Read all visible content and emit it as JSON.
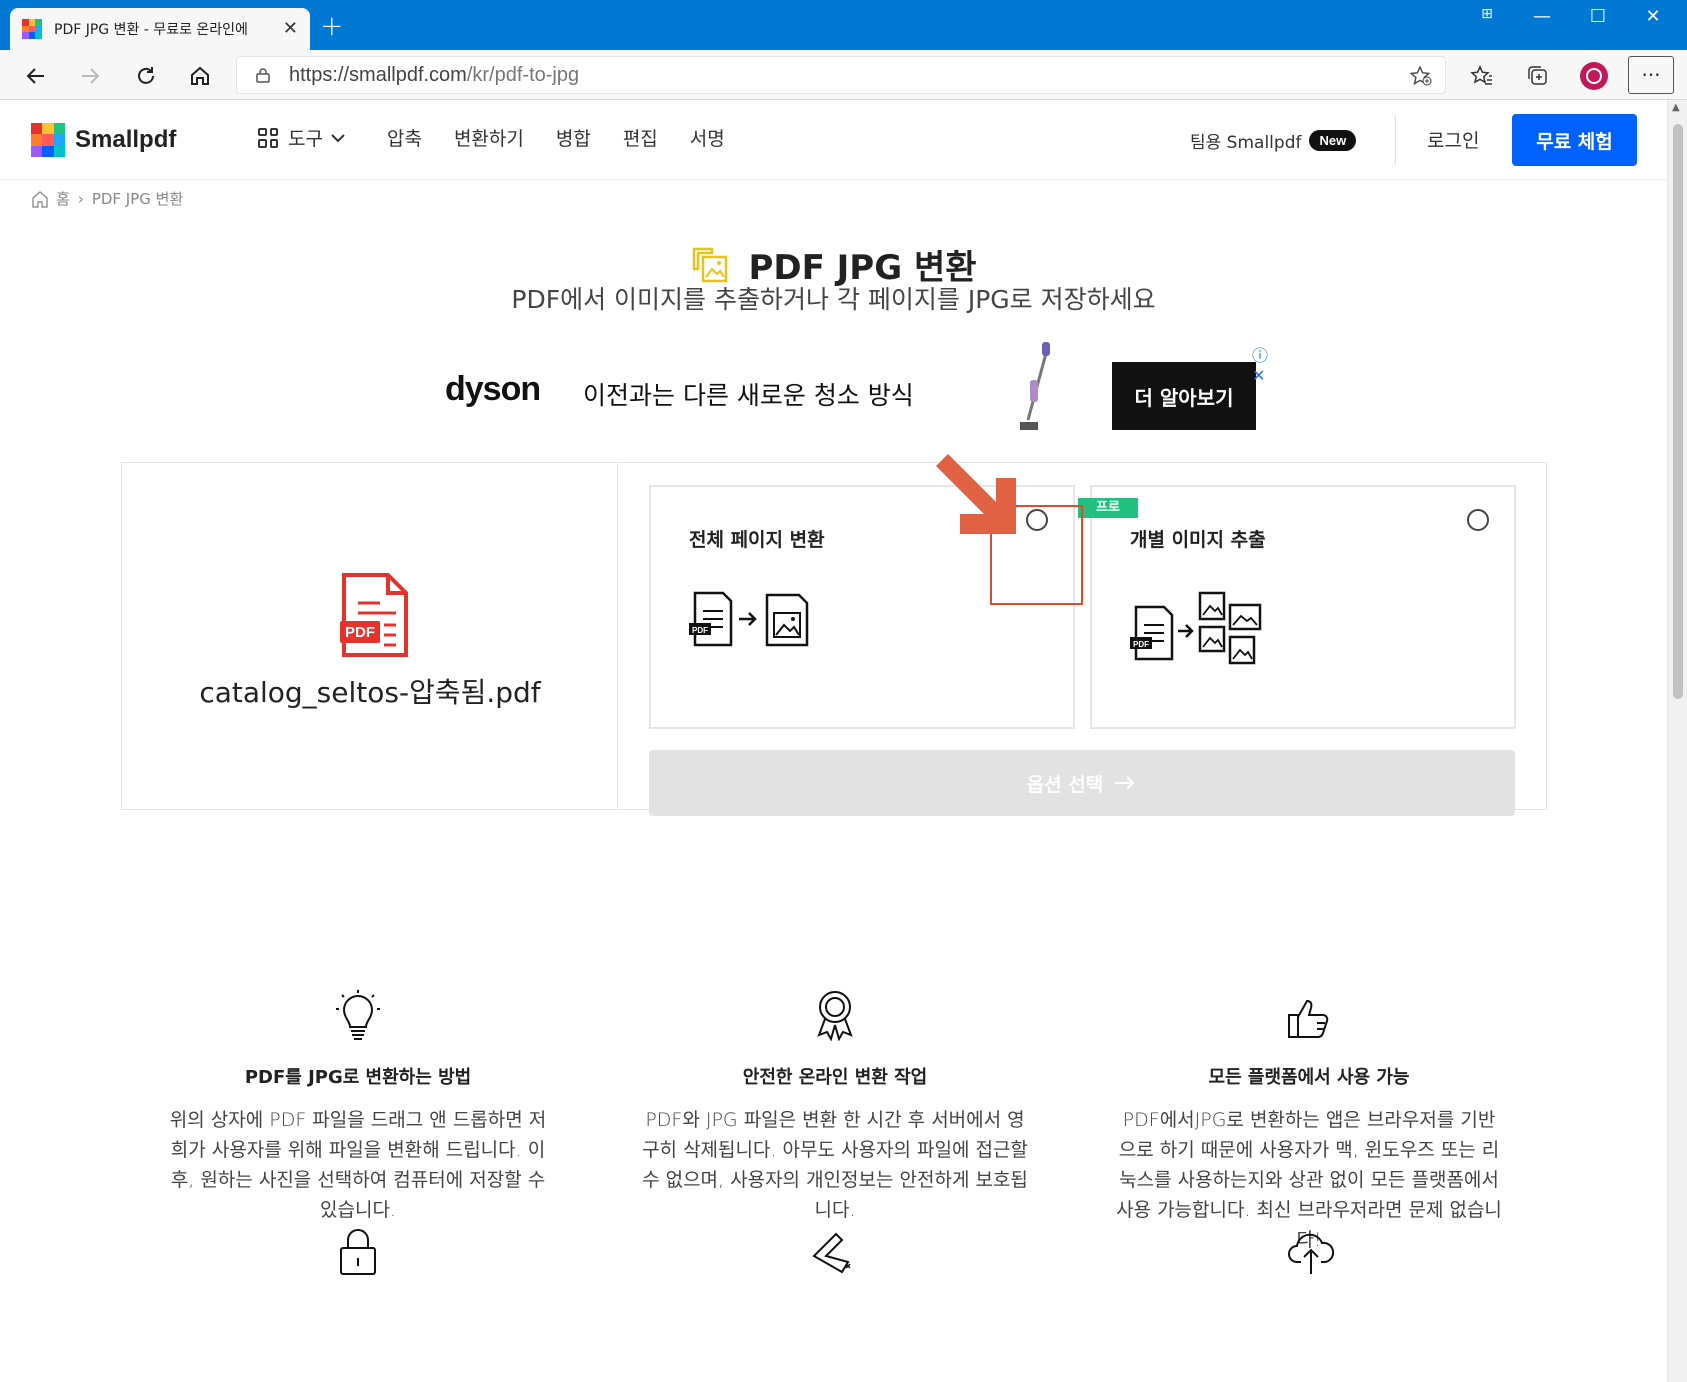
{
  "browser": {
    "tab_title": "PDF JPG 변환 - 무료로 온라인에",
    "url_main": "https://smallpdf.com",
    "url_path": "/kr/pdf-to-jpg"
  },
  "header": {
    "logo": "Smallpdf",
    "tools_label": "도구",
    "nav": [
      "압축",
      "변환하기",
      "병합",
      "편집",
      "서명"
    ],
    "team_label": "팀용 Smallpdf",
    "new_badge": "New",
    "login": "로그인",
    "trial": "무료 체험"
  },
  "breadcrumb": {
    "home": "홈",
    "sep": "›",
    "current": "PDF JPG 변환"
  },
  "hero": {
    "title": "PDF JPG 변환",
    "subtitle": "PDF에서 이미지를 추출하거나 각 페이지를 JPG로 저장하세요"
  },
  "ad": {
    "brand": "dyson",
    "text": "이전과는 다른 새로운 청소 방식",
    "cta": "더 알아보기"
  },
  "tool": {
    "file_name": "catalog_seltos-압축됨.pdf",
    "pdf_label": "PDF",
    "options": [
      {
        "title": "전체 페이지 변환",
        "selected": false
      },
      {
        "title": "개별 이미지 추출",
        "selected": false,
        "pro": "프로"
      }
    ],
    "select_button": "옵션 선택"
  },
  "features": [
    {
      "icon": "lightbulb-icon",
      "title": "PDF를 JPG로 변환하는 방법",
      "text": "위의 상자에 PDF 파일을 드래그 앤 드롭하면 저희가 사용자를 위해 파일을 변환해 드립니다. 이후, 원하는 사진을 선택하여 컴퓨터에 저장할 수 있습니다."
    },
    {
      "icon": "award-ribbon-icon",
      "title": "안전한 온라인 변환 작업",
      "text": "PDF와 JPG 파일은 변환 한 시간 후 서버에서 영구히 삭제됩니다. 아무도 사용자의 파일에 접근할 수 없으며, 사용자의 개인정보는 안전하게 보호됩니다."
    },
    {
      "icon": "thumbs-up-icon",
      "title": "모든 플랫폼에서 사용 가능",
      "text": "PDF에서JPG로 변환하는 앱은 브라우저를 기반으로 하기 때문에 사용자가 맥, 윈도우즈 또는 리눅스를 사용하는지와 상관 없이 모든 플랫폼에서 사용 가능합니다. 최신 브라우저라면 문제 없습니다!"
    }
  ],
  "colors": {
    "browser_blue": "#0078d4",
    "primary": "#0061fe",
    "pro_green": "#23c17f",
    "pdf_red": "#e5322d",
    "annotation": "#e14a2e"
  }
}
